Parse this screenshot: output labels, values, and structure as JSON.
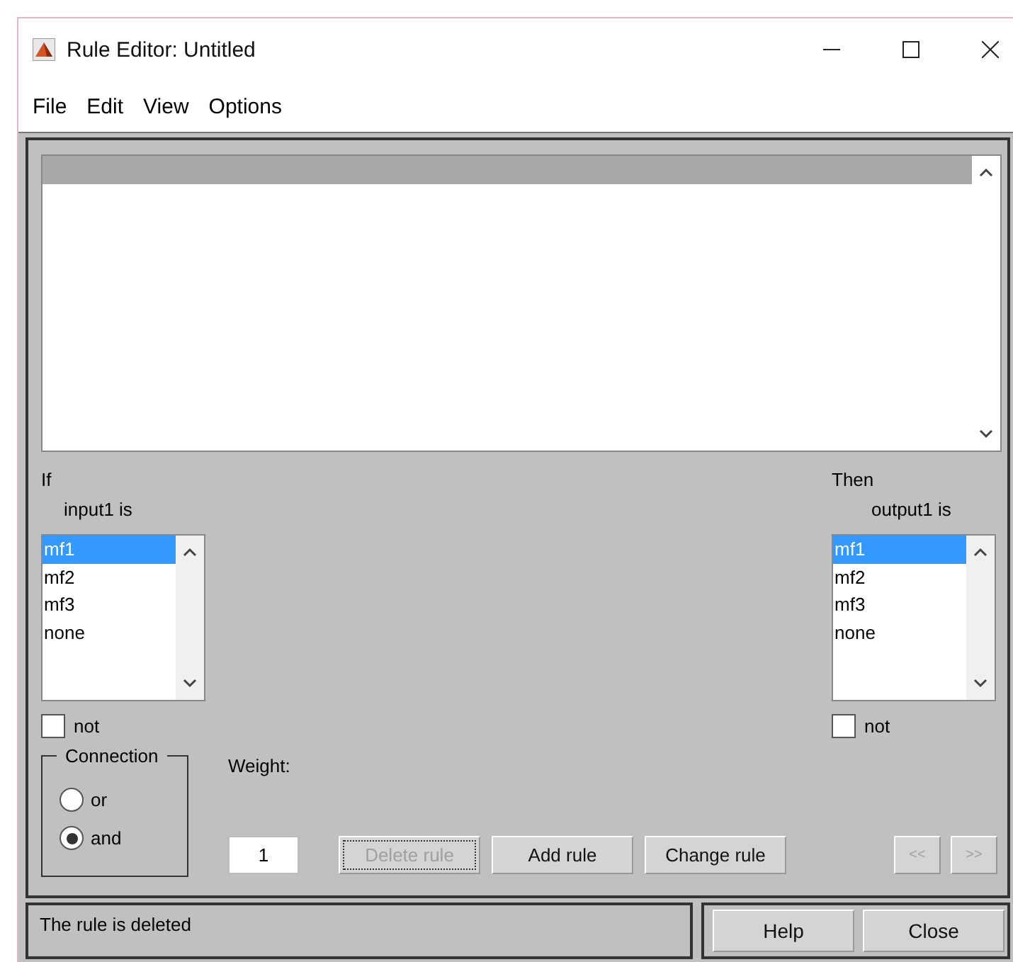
{
  "window": {
    "title": "Rule Editor: Untitled"
  },
  "menu": [
    "File",
    "Edit",
    "View",
    "Options"
  ],
  "rules": {
    "highlighted_row": true
  },
  "antecedent": {
    "heading": "If",
    "label": "input1 is",
    "options": [
      {
        "label": "mf1",
        "selected": true
      },
      {
        "label": "mf2",
        "selected": false
      },
      {
        "label": "mf3",
        "selected": false
      },
      {
        "label": "none",
        "selected": false
      }
    ],
    "not": {
      "label": "not",
      "checked": false
    }
  },
  "consequent": {
    "heading": "Then",
    "label": "output1 is",
    "options": [
      {
        "label": "mf1",
        "selected": true
      },
      {
        "label": "mf2",
        "selected": false
      },
      {
        "label": "mf3",
        "selected": false
      },
      {
        "label": "none",
        "selected": false
      }
    ],
    "not": {
      "label": "not",
      "checked": false
    }
  },
  "connection": {
    "title": "Connection",
    "options": [
      {
        "label": "or",
        "selected": false
      },
      {
        "label": "and",
        "selected": true
      }
    ]
  },
  "weight": {
    "label": "Weight:",
    "value": "1"
  },
  "rule_buttons": [
    {
      "label": "Delete rule",
      "disabled": true
    },
    {
      "label": "Add rule",
      "disabled": false
    },
    {
      "label": "Change rule",
      "disabled": false
    }
  ],
  "nav_buttons": [
    {
      "label": "<<",
      "disabled": true
    },
    {
      "label": ">>",
      "disabled": true
    }
  ],
  "status": "The rule is deleted",
  "footer_buttons": [
    "Help",
    "Close"
  ]
}
